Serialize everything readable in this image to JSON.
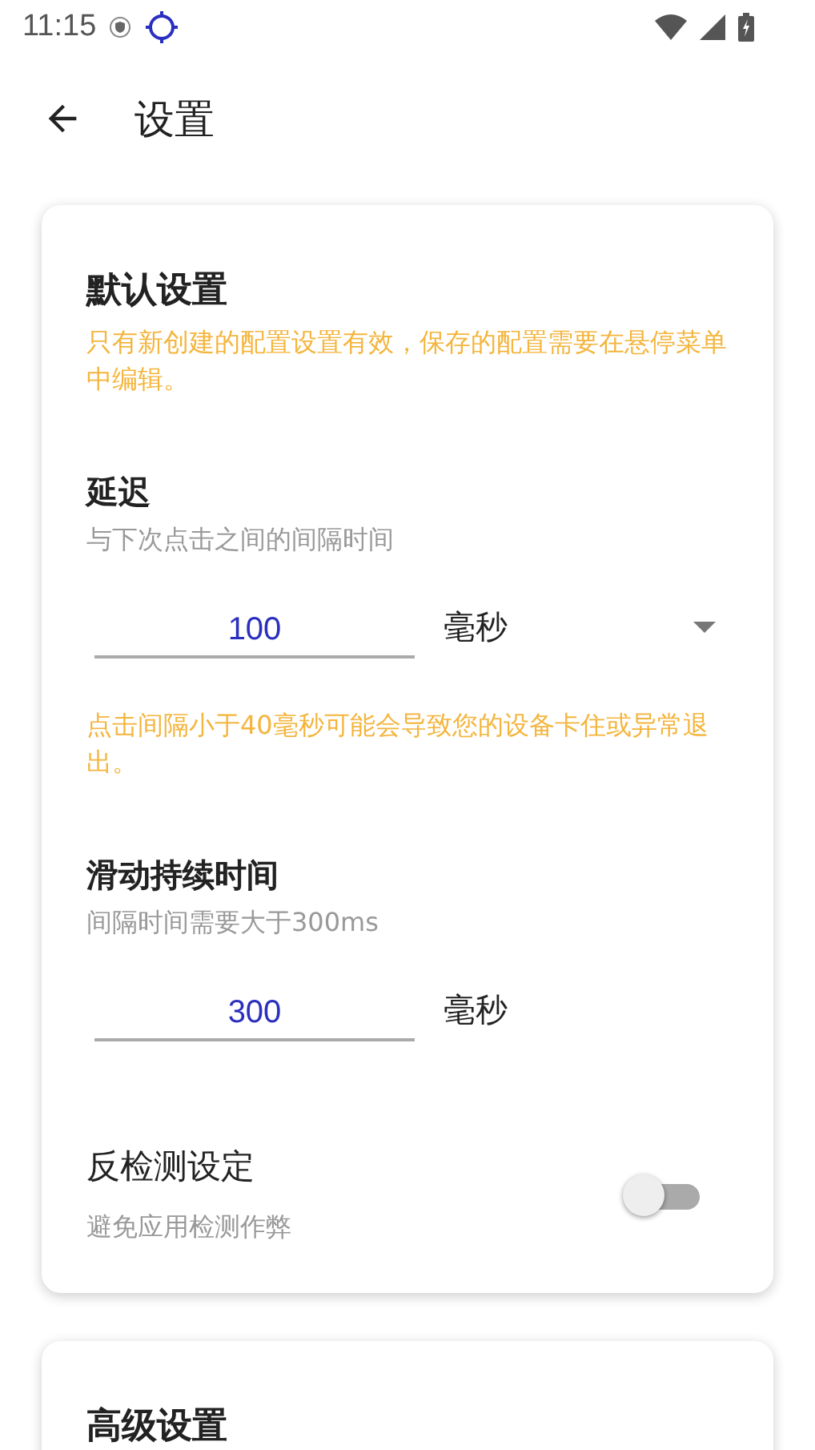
{
  "status_bar": {
    "time": "11:15"
  },
  "app_bar": {
    "title": "设置"
  },
  "cards": [
    {
      "title": "默认设置",
      "note": "只有新创建的配置设置有效，保存的配置需要在悬停菜单中编辑。",
      "settings": [
        {
          "kind": "number",
          "title": "延迟",
          "subtitle": "与下次点击之间的间隔时间",
          "value": "100",
          "unit": "毫秒",
          "dropdown": true,
          "warning": "点击间隔小于40毫秒可能会导致您的设备卡住或异常退出。"
        },
        {
          "kind": "number",
          "title": "滑动持续时间",
          "subtitle": "间隔时间需要大于300ms",
          "value": "300",
          "unit": "毫秒",
          "dropdown": false
        },
        {
          "kind": "toggle",
          "title": "反检测设定",
          "subtitle": "避免应用检测作弊",
          "on": false
        }
      ]
    },
    {
      "title": "高级设置"
    }
  ]
}
